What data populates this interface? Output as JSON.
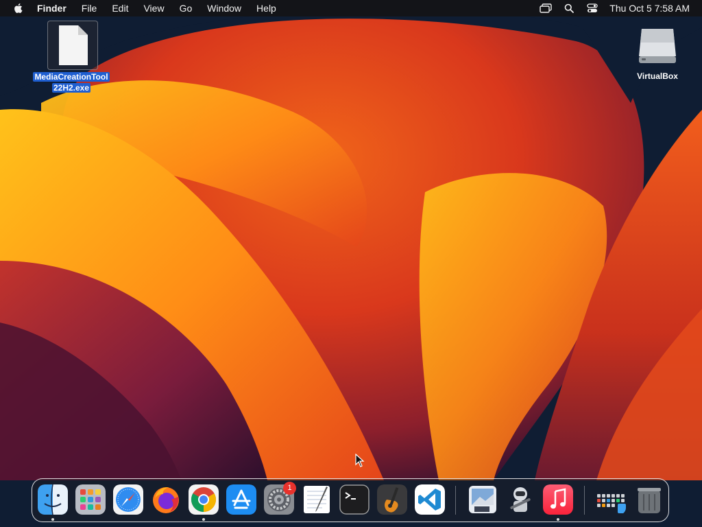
{
  "menubar": {
    "app_name": "Finder",
    "menus": [
      "File",
      "Edit",
      "View",
      "Go",
      "Window",
      "Help"
    ],
    "clock": "Thu Oct 5  7:58 AM",
    "icons": [
      "apple-logo-icon",
      "screen-mirroring-icon",
      "spotlight-search-icon",
      "control-center-icon"
    ]
  },
  "desktop": {
    "file": {
      "line1": "MediaCreationTool",
      "line2": "22H2.exe"
    },
    "volume": {
      "label": "VirtualBox"
    }
  },
  "dock": {
    "apps": [
      "finder",
      "launchpad",
      "safari",
      "firefox",
      "chrome",
      "app-store",
      "system-settings",
      "textedit",
      "terminal",
      "garageband",
      "vscode",
      "preview",
      "automator",
      "music",
      "applications-stack",
      "trash"
    ],
    "system_settings_badge": "1"
  },
  "colors": {
    "menubar_bg": "#141416",
    "selection": "#1f5fd1",
    "badge": "#e8322c"
  }
}
